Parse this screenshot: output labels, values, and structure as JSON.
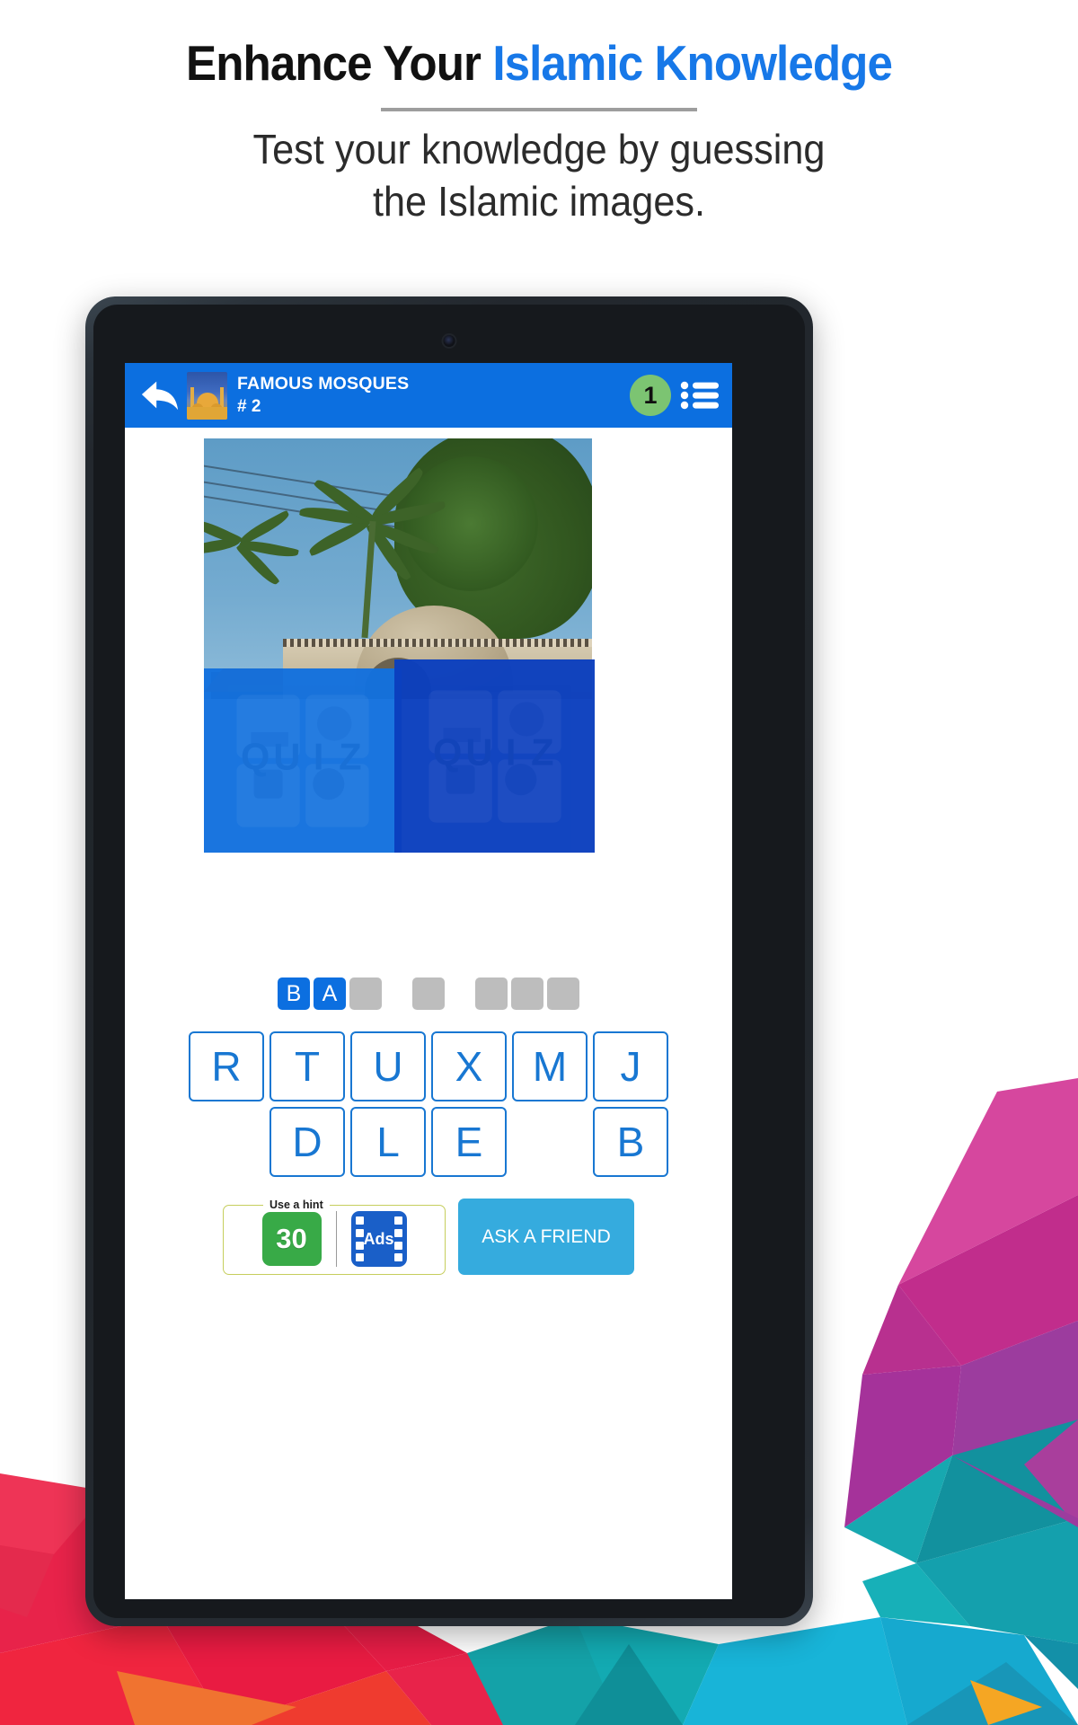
{
  "promo": {
    "headline_black": "Enhance Your",
    "headline_blue": "Islamic Knowledge",
    "subhead_line1": "Test your knowledge by guessing",
    "subhead_line2": "the Islamic images.",
    "accent_blue": "#1778E8",
    "headline_black_color": "#111111"
  },
  "app": {
    "header": {
      "back_icon": "back-arrow-icon",
      "category_thumb": "mosque-thumbnail",
      "category_title": "FAMOUS MOSQUES",
      "level_label": "# 2",
      "score": "1",
      "score_badge_color": "#7CC472",
      "list_icon": "list-menu-icon",
      "bar_color": "#0C6FE0"
    },
    "puzzle": {
      "image_alt": "stone domed mosque with palm trees",
      "overlay_watermark": "QUIZ",
      "overlay_color_light": "#1371DE",
      "overlay_color_dark": "#0B3FBE"
    },
    "answer": {
      "slots": [
        {
          "letter": "B",
          "filled": true
        },
        {
          "letter": "A",
          "filled": true
        },
        {
          "letter": "",
          "filled": false
        },
        {
          "gap": true
        },
        {
          "letter": "",
          "filled": false
        },
        {
          "gap": true
        },
        {
          "letter": "",
          "filled": false
        },
        {
          "letter": "",
          "filled": false
        },
        {
          "letter": "",
          "filled": false
        }
      ],
      "filled_color": "#0C6FE0",
      "empty_color": "#bdbdbd"
    },
    "keyboard": {
      "row1": [
        "R",
        "T",
        "U",
        "X",
        "M",
        "J"
      ],
      "row2": [
        "",
        "D",
        "L",
        "E",
        "",
        "B"
      ],
      "key_color": "#1877D2"
    },
    "bottom": {
      "hint_legend": "Use a hint",
      "coin_value": "30",
      "coin_color": "#38AA47",
      "ads_label": "Ads",
      "ads_color": "#1A5FC8",
      "ask_label": "ASK A FRIEND",
      "ask_color": "#35ABDE",
      "hint_border_color": "#c6ce5d"
    }
  }
}
